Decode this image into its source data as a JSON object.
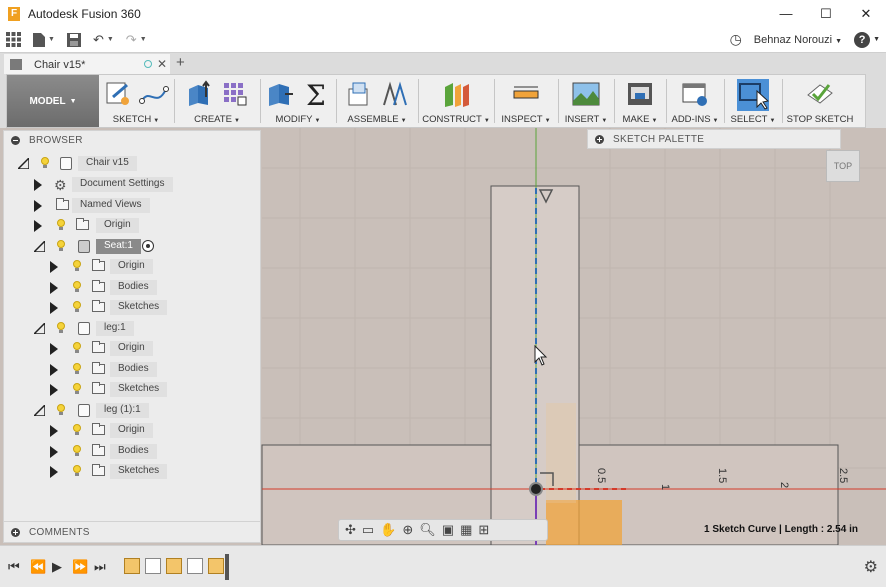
{
  "window": {
    "title": "Autodesk Fusion 360",
    "app_icon_letter": "F",
    "controls": [
      "—",
      "☐",
      "✕"
    ]
  },
  "quickbar": {
    "user": "Behnaz Norouzi",
    "help": "?"
  },
  "document": {
    "tab_title": "Chair v15*",
    "close": "✕",
    "new_tab": "+"
  },
  "ribbon": {
    "workspace": "MODEL",
    "groups": [
      "SKETCH",
      "CREATE",
      "MODIFY",
      "ASSEMBLE",
      "CONSTRUCT",
      "INSPECT",
      "INSERT",
      "MAKE",
      "ADD-INS",
      "SELECT",
      "STOP SKETCH"
    ]
  },
  "browser": {
    "title": "BROWSER",
    "root": "Chair v15",
    "document_settings": "Document Settings",
    "named_views": "Named Views",
    "origin": "Origin",
    "seat": "Seat:1",
    "seat_children": [
      "Origin",
      "Bodies",
      "Sketches"
    ],
    "leg": "leg:1",
    "leg_children": [
      "Origin",
      "Bodies",
      "Sketches"
    ],
    "leg2": "leg (1):1",
    "leg2_children": [
      "Origin",
      "Bodies",
      "Sketches"
    ]
  },
  "comments": {
    "title": "COMMENTS"
  },
  "palette": {
    "title": "SKETCH PALETTE"
  },
  "viewcube": {
    "face": "TOP"
  },
  "dimensions": [
    "0.5",
    "1",
    "1.5",
    "2",
    "2.5"
  ],
  "status": "1 Sketch Curve | Length : 2.54 in",
  "colors": {
    "viewport_bg": "#c9bfb9",
    "accent_blue": "#2f6fb5",
    "axis_red": "#d43b2a",
    "axis_green": "#5aa43b",
    "highlight_orange": "#f0a33a"
  }
}
